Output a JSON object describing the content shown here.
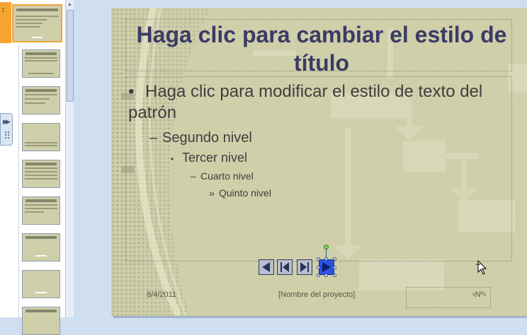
{
  "thumbnails": {
    "active_index": "1",
    "items": [
      {
        "name": "slide-thumbnail-1"
      },
      {
        "name": "slide-thumbnail-2"
      },
      {
        "name": "slide-thumbnail-3"
      },
      {
        "name": "slide-thumbnail-4"
      },
      {
        "name": "slide-thumbnail-5"
      },
      {
        "name": "slide-thumbnail-6"
      },
      {
        "name": "slide-thumbnail-7"
      },
      {
        "name": "slide-thumbnail-8"
      },
      {
        "name": "slide-thumbnail-9"
      }
    ]
  },
  "slide": {
    "title": "Haga clic para cambiar el estilo de título",
    "body": {
      "level1": "Haga clic para modificar el estilo de texto del patrón",
      "level2": "Segundo nivel",
      "level3": "Tercer nivel",
      "level4": "Cuarto nivel",
      "level5": "Quinto nivel"
    },
    "bullets": {
      "level1": "•",
      "level2": "–",
      "level3": "•",
      "level4": "–",
      "level5": "»"
    },
    "footer": {
      "date": "8/4/2011",
      "project": "[Nombre del proyecto]",
      "slide_number": "‹Nº›"
    },
    "nav_buttons": [
      "back-icon",
      "first-slide-icon",
      "last-slide-icon",
      "next-icon"
    ]
  },
  "colors": {
    "slide_background": "#cfcfaa",
    "title": "#3b3b66",
    "thumbnail_selected_border": "#f1a33b",
    "nav_selected": "#2c52e4"
  }
}
